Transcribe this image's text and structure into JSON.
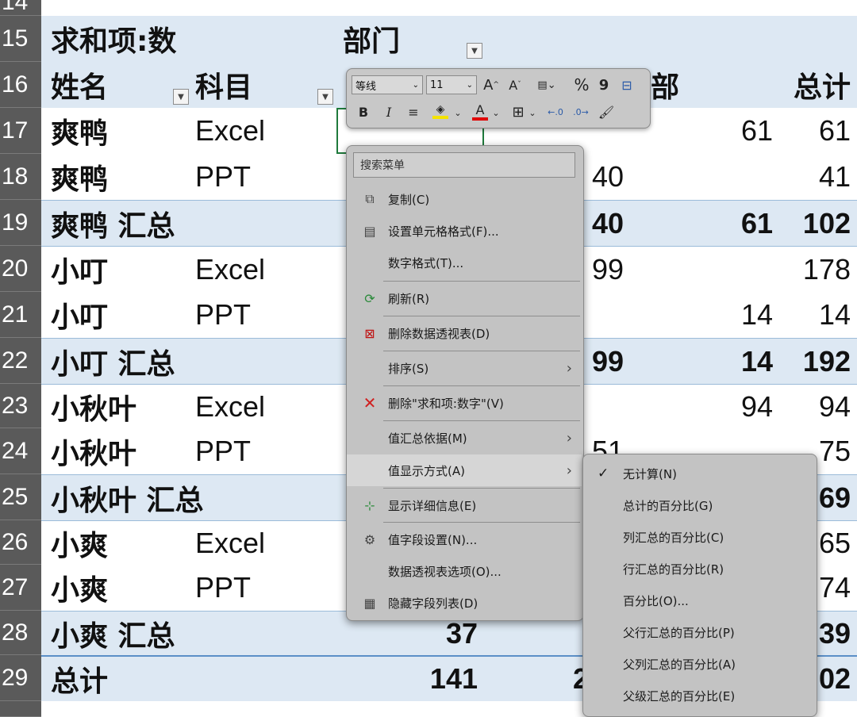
{
  "sheet": {
    "row_numbers": [
      "14",
      "15",
      "16",
      "17",
      "18",
      "19",
      "20",
      "21",
      "22",
      "23",
      "24",
      "25",
      "26",
      "27",
      "28",
      "29"
    ],
    "r15": {
      "a": "求和项:数",
      "c": "部门"
    },
    "r16": {
      "a": "姓名",
      "b": "科目",
      "d": "部",
      "e": "总计"
    },
    "r17": {
      "a": "爽鸭",
      "b": "Excel",
      "d": "61",
      "e": "61"
    },
    "r18": {
      "a": "爽鸭",
      "b": "PPT",
      "c2": "40",
      "e": "41"
    },
    "r19": {
      "a": "爽鸭 汇总",
      "c2": "40",
      "d": "61",
      "e": "102"
    },
    "r20": {
      "a": "小叮",
      "b": "Excel",
      "c2": "99",
      "e": "178"
    },
    "r21": {
      "a": "小叮",
      "b": "PPT",
      "d": "14",
      "e": "14"
    },
    "r22": {
      "a": "小叮 汇总",
      "c2": "99",
      "d": "14",
      "e": "192"
    },
    "r23": {
      "a": "小秋叶",
      "b": "Excel",
      "d": "94",
      "e": "94"
    },
    "r24": {
      "a": "小秋叶",
      "b": "PPT",
      "c2": "51",
      "e": "75"
    },
    "r25": {
      "a": "小秋叶 汇总",
      "e": "69"
    },
    "r26": {
      "a": "小爽",
      "b": "Excel",
      "e": "65"
    },
    "r27": {
      "a": "小爽",
      "b": "PPT",
      "e": "74"
    },
    "r28": {
      "a": "小爽 汇总",
      "c": "37",
      "e": "39"
    },
    "r29": {
      "a": "总计",
      "c": "141",
      "c2": "2",
      "e": "02"
    }
  },
  "toolbar": {
    "font": "等线",
    "size": "11",
    "grow": "A",
    "shrink": "A",
    "percent": "%",
    "comma": "9",
    "bold": "B",
    "italic": "I",
    "fontcolor": "A"
  },
  "menu": {
    "search": "搜索菜单",
    "items": [
      {
        "label": "复制(C)"
      },
      {
        "label": "设置单元格格式(F)..."
      },
      {
        "label": "数字格式(T)..."
      },
      {
        "label": "刷新(R)"
      },
      {
        "label": "删除数据透视表(D)"
      },
      {
        "label": "排序(S)"
      },
      {
        "label": "删除\"求和项:数字\"(V)"
      },
      {
        "label": "值汇总依据(M)"
      },
      {
        "label": "值显示方式(A)"
      },
      {
        "label": "显示详细信息(E)"
      },
      {
        "label": "值字段设置(N)..."
      },
      {
        "label": "数据透视表选项(O)..."
      },
      {
        "label": "隐藏字段列表(D)"
      }
    ],
    "arrow": "›"
  },
  "submenu": {
    "check": "✓",
    "items": [
      {
        "label": "无计算(N)"
      },
      {
        "label": "总计的百分比(G)"
      },
      {
        "label": "列汇总的百分比(C)"
      },
      {
        "label": "行汇总的百分比(R)"
      },
      {
        "label": "百分比(O)..."
      },
      {
        "label": "父行汇总的百分比(P)"
      },
      {
        "label": "父列汇总的百分比(A)"
      },
      {
        "label": "父级汇总的百分比(E)"
      }
    ]
  }
}
